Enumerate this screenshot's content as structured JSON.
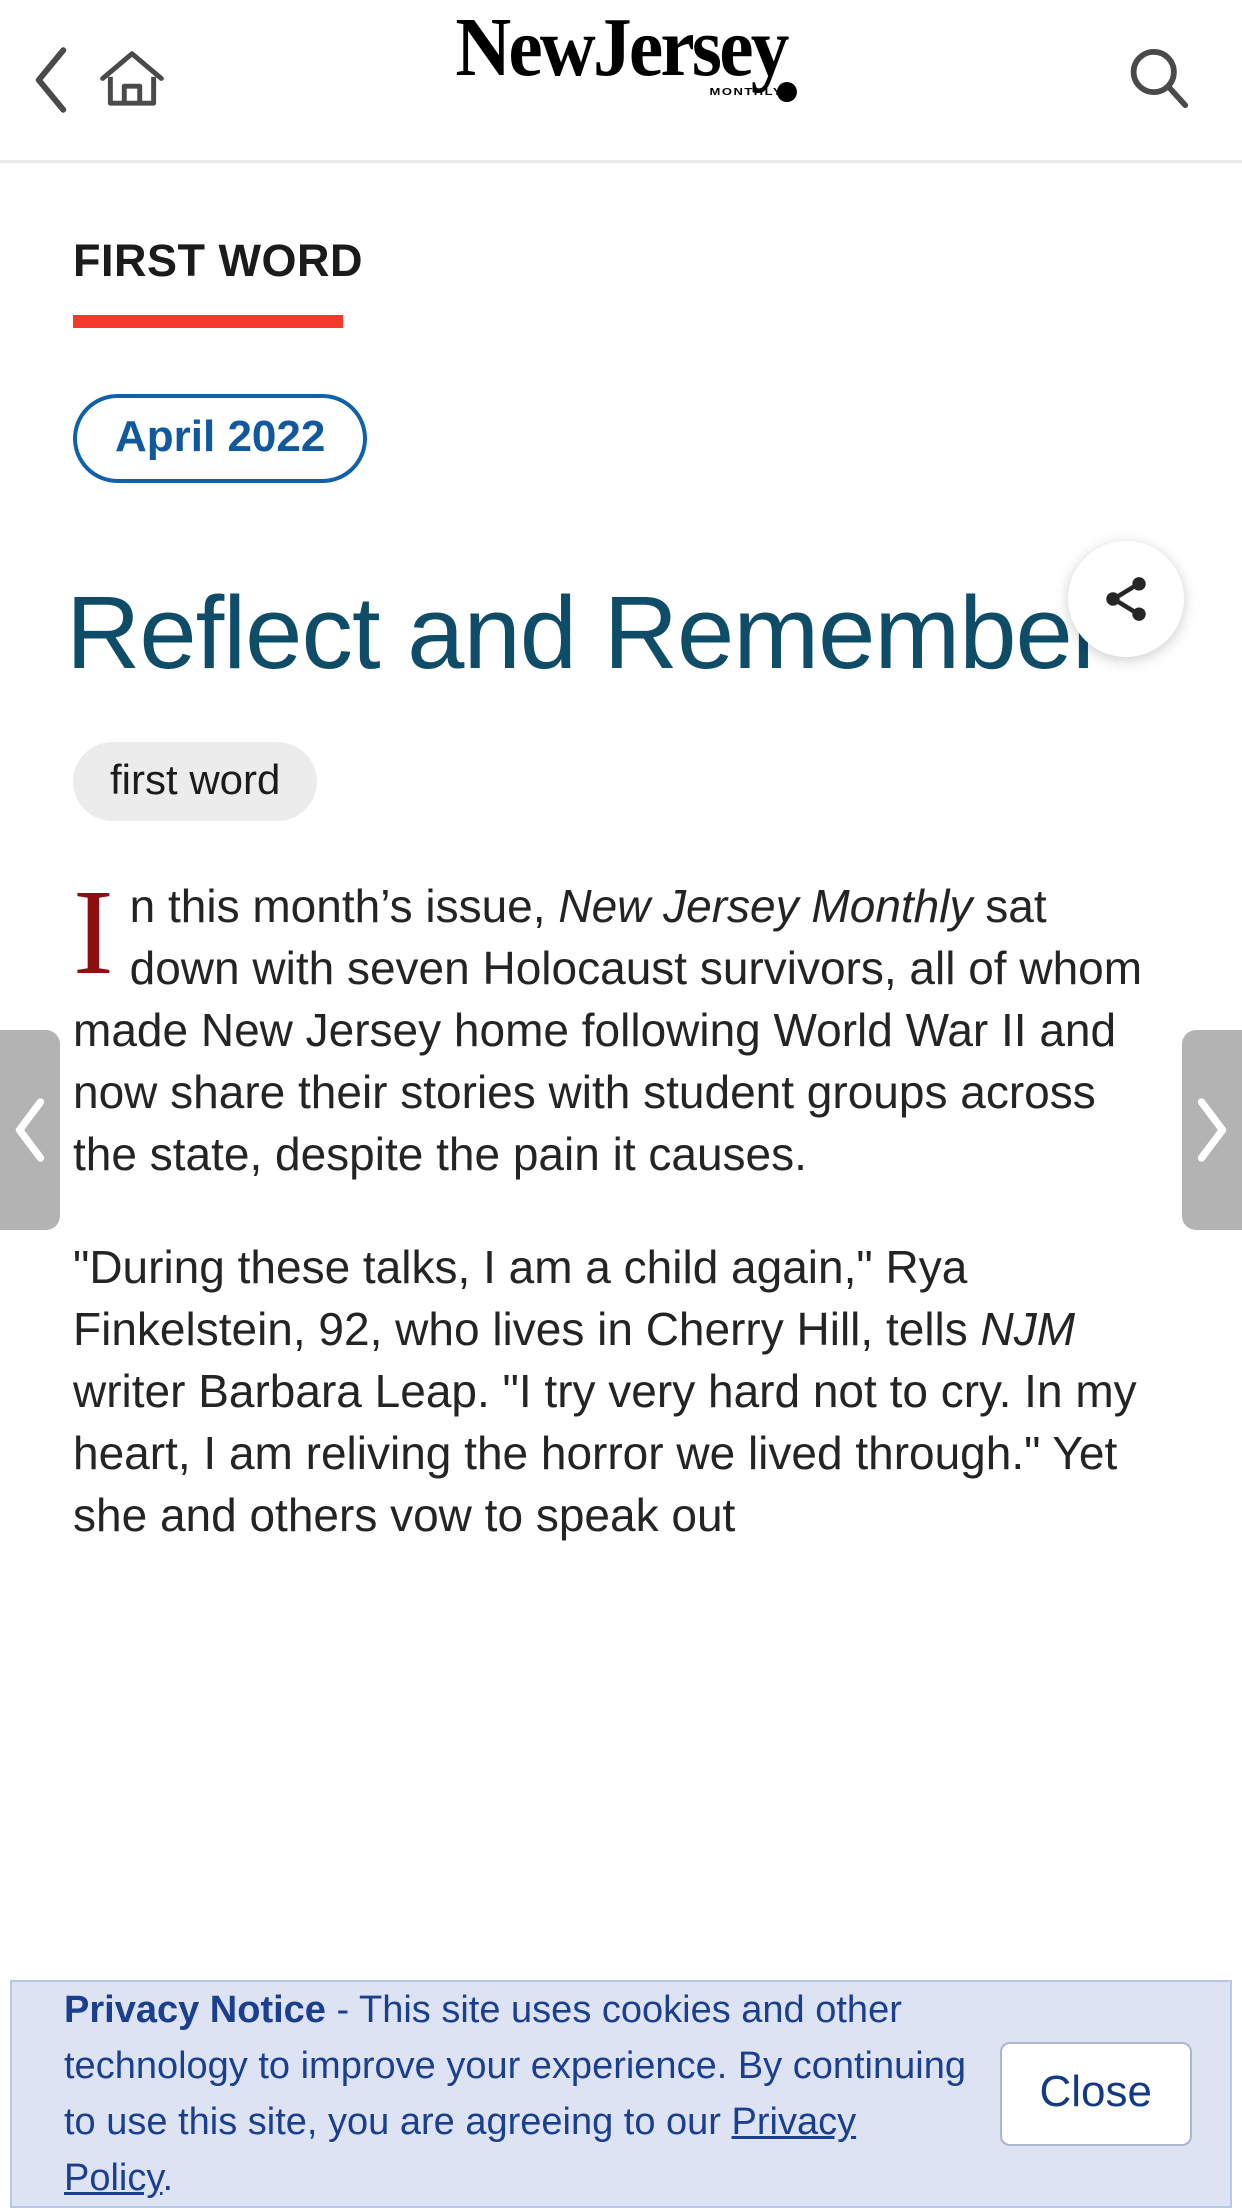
{
  "header": {
    "back_icon": "chevron-left-icon",
    "home_icon": "home-icon",
    "search_icon": "search-icon",
    "brand_name": "NewJersey",
    "brand_subtitle": "MONTHLY"
  },
  "article": {
    "kicker": "FIRST WORD",
    "kicker_rule_color": "#f5392d",
    "issue_label": "April 2022",
    "issue_color": "#10599f",
    "share_icon": "share-icon",
    "title": "Reflect and Remember",
    "title_color": "#0e4c68",
    "tag": "first word",
    "dropcap": "I",
    "dropcap_color": "#8e0f12",
    "paragraph1_part1": "n this month’s issue, ",
    "paragraph1_italic": "New Jersey Monthly",
    "paragraph1_part2": " sat down with seven Holocaust survivors, all of whom made New Jersey home following World War II and now share their stories with student groups across the state, despite the pain it causes.",
    "paragraph2_part1": "\"During these talks, I am a child again,\" Rya Finkelstein, 92, who lives in Cherry Hill, tells ",
    "paragraph2_italic": "NJM",
    "paragraph2_part2": " writer Barbara Leap. \"I try very hard not to cry. In my heart, I am reliving the horror we lived through.\" Yet she and others vow to speak out"
  },
  "carousel": {
    "prev_icon": "chevron-left-icon",
    "next_icon": "chevron-right-icon"
  },
  "privacy": {
    "title": "Privacy Notice",
    "separator": " - ",
    "body_part1": "This site uses cookies and other technology to improve your experience. By continuing to use this site, you are agreeing to our ",
    "link_text": "Privacy Policy",
    "body_part2": ".",
    "close_label": "Close",
    "background_color": "#dde3f3",
    "text_color": "#1b3f8f"
  }
}
